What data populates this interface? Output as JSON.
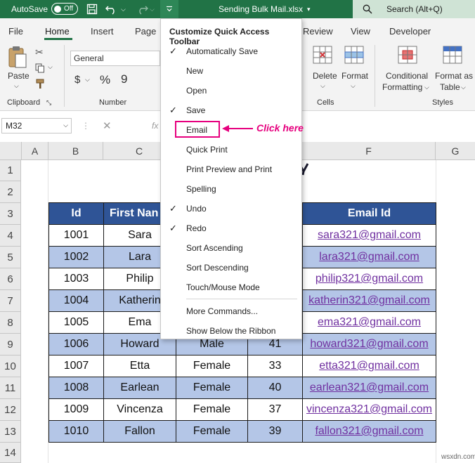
{
  "titlebar": {
    "autosave_label": "AutoSave",
    "toggle_state": "Off",
    "filename": "Sending Bulk Mail.xlsx",
    "search_placeholder": "Search (Alt+Q)"
  },
  "tabs": [
    "File",
    "Home",
    "Insert",
    "Page",
    "Review",
    "View",
    "Developer"
  ],
  "ribbon": {
    "paste_label": "Paste",
    "clipboard_label": "Clipboard",
    "number_format": "General",
    "number_label": "Number",
    "delete_label": "Delete",
    "format_label": "Format",
    "cells_label": "Cells",
    "conditional_formatting": [
      "Conditional",
      "Formatting"
    ],
    "format_as_table": [
      "Format as",
      "Table"
    ],
    "styles_label": "Styles"
  },
  "namebox": "M32",
  "formula_fx": "fx",
  "columns": [
    "A",
    "B",
    "C",
    "F",
    "G"
  ],
  "rows": [
    "1",
    "2",
    "3",
    "4",
    "5",
    "6",
    "7",
    "8",
    "9",
    "10",
    "11",
    "12",
    "13",
    "14"
  ],
  "table": {
    "headers": {
      "id": "Id",
      "first_name": "First Nan",
      "email": "Email Id"
    },
    "records": [
      {
        "id": "1001",
        "name": "Sara",
        "gender": "",
        "age": "",
        "email": "sara321@gmail.com"
      },
      {
        "id": "1002",
        "name": "Lara",
        "gender": "",
        "age": "",
        "email": "lara321@gmail.com"
      },
      {
        "id": "1003",
        "name": "Philip",
        "gender": "",
        "age": "",
        "email": "philip321@gmail.com"
      },
      {
        "id": "1004",
        "name": "Katherin",
        "gender": "",
        "age": "",
        "email": "katherin321@gmail.com"
      },
      {
        "id": "1005",
        "name": "Ema",
        "gender": "",
        "age": "",
        "email": "ema321@gmail.com"
      },
      {
        "id": "1006",
        "name": "Howard",
        "gender": "Male",
        "age": "41",
        "email": "howard321@gmail.com"
      },
      {
        "id": "1007",
        "name": "Etta",
        "gender": "Female",
        "age": "33",
        "email": "etta321@gmail.com"
      },
      {
        "id": "1008",
        "name": "Earlean",
        "gender": "Female",
        "age": "40",
        "email": "earlean321@gmail.com"
      },
      {
        "id": "1009",
        "name": "Vincenza",
        "gender": "Female",
        "age": "37",
        "email": "vincenza321@gmail.com"
      },
      {
        "id": "1010",
        "name": "Fallon",
        "gender": "Female",
        "age": "39",
        "email": "fallon321@gmail.com"
      }
    ]
  },
  "menu": {
    "title": "Customize Quick Access Toolbar",
    "items": [
      {
        "label": "Automatically Save",
        "checked": "✓"
      },
      {
        "label": "New",
        "checked": ""
      },
      {
        "label": "Open",
        "checked": ""
      },
      {
        "label": "Save",
        "checked": "✓"
      },
      {
        "label": "Email",
        "checked": ""
      },
      {
        "label": "Quick Print",
        "checked": ""
      },
      {
        "label": "Print Preview and Print",
        "checked": ""
      },
      {
        "label": "Spelling",
        "checked": ""
      },
      {
        "label": "Undo",
        "checked": "✓"
      },
      {
        "label": "Redo",
        "checked": "✓"
      },
      {
        "label": "Sort Ascending",
        "checked": ""
      },
      {
        "label": "Sort Descending",
        "checked": ""
      },
      {
        "label": "Touch/Mouse Mode",
        "checked": ""
      },
      {
        "label": "More Commands...",
        "checked": ""
      },
      {
        "label": "Show Below the Ribbon",
        "checked": ""
      }
    ]
  },
  "annotation": "Click here",
  "watermark": "wsxdn.com",
  "colors": {
    "excel_green": "#217346",
    "header_blue": "#2f5496",
    "row_blue": "#b4c6e7",
    "link_purple": "#7030a0",
    "annotation_pink": "#e6007e"
  }
}
